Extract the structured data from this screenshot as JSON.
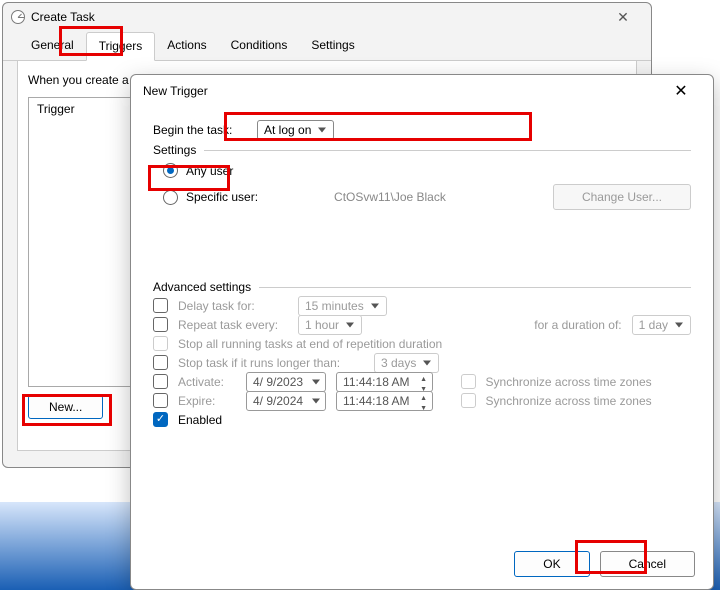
{
  "createTask": {
    "title": "Create Task",
    "tabs": [
      "General",
      "Triggers",
      "Actions",
      "Conditions",
      "Settings"
    ],
    "activeTab": "Triggers",
    "intro": "When you create a t",
    "listHeader": "Trigger",
    "newBtn": "New..."
  },
  "newTrigger": {
    "title": "New Trigger",
    "beginLabel": "Begin the task:",
    "beginValue": "At log on",
    "settingsHead": "Settings",
    "anyUser": "Any user",
    "specificUser": "Specific user:",
    "specificUserValue": "CtOSvw11\\Joe Black",
    "changeUser": "Change User...",
    "advHead": "Advanced settings",
    "delay": {
      "label": "Delay task for:",
      "value": "15 minutes"
    },
    "repeat": {
      "label": "Repeat task every:",
      "value": "1 hour",
      "durLabel": "for a duration of:",
      "durValue": "1 day"
    },
    "stopAll": "Stop all running tasks at end of repetition duration",
    "stopIf": {
      "label": "Stop task if it runs longer than:",
      "value": "3 days"
    },
    "activate": {
      "label": "Activate:",
      "date": "4/  9/2023",
      "time": "11:44:18 AM"
    },
    "expire": {
      "label": "Expire:",
      "date": "4/  9/2024",
      "time": "11:44:18 AM"
    },
    "sync": "Synchronize across time zones",
    "enabled": "Enabled",
    "ok": "OK",
    "cancel": "Cancel"
  }
}
